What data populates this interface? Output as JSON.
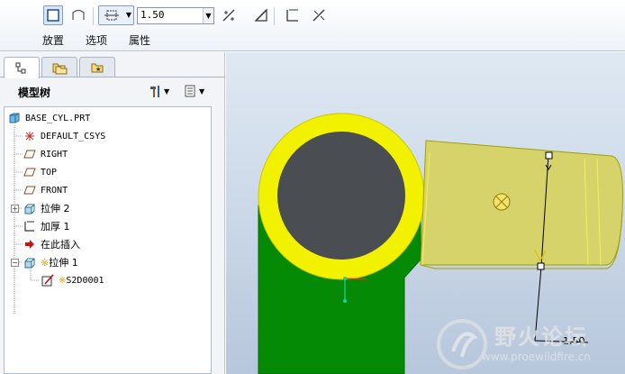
{
  "dashboard": {
    "tabs": [
      "放置",
      "选项",
      "属性"
    ],
    "thickness": {
      "value": "1.50"
    },
    "icons": [
      "solid-icon",
      "surface-icon",
      "depth-option-icon",
      "flip-direction-icon",
      "remove-material-icon",
      "thicken-icon",
      "flip-thicken-icon"
    ]
  },
  "navigator": {
    "title": "模型树",
    "tab_icons": [
      "model-tree-icon",
      "folder-browser-icon",
      "favorites-icon"
    ],
    "items": [
      {
        "label": "BASE_CYL.PRT",
        "icon": "part-icon",
        "mono": true
      },
      {
        "label": "DEFAULT_CSYS",
        "icon": "csys-icon",
        "mono": true
      },
      {
        "label": "RIGHT",
        "icon": "datum-plane-icon",
        "mono": true
      },
      {
        "label": "TOP",
        "icon": "datum-plane-icon",
        "mono": true
      },
      {
        "label": "FRONT",
        "icon": "datum-plane-icon",
        "mono": true
      },
      {
        "label": "拉伸 2",
        "icon": "extrude-icon",
        "mono": false
      },
      {
        "label": "加厚 1",
        "icon": "thicken-feature-icon",
        "mono": false
      },
      {
        "label": "在此插入",
        "icon": "insert-here-arrow-icon",
        "mono": false
      },
      {
        "label": "拉伸 1",
        "prefix": "※",
        "icon": "extrude-icon",
        "mono": false
      },
      {
        "label": "S2D0001",
        "prefix": "※",
        "icon": "sketch-icon",
        "mono": true
      }
    ]
  },
  "graphics": {
    "dimension": "1.50",
    "watermark": {
      "title": "野火论坛",
      "url": "www.proewildfire.cn"
    },
    "colors": {
      "cylinder": "#058a05",
      "end_ring": "#f2f200",
      "hole": "#4a4d52",
      "thicken_surface": "#d6d36a"
    }
  }
}
